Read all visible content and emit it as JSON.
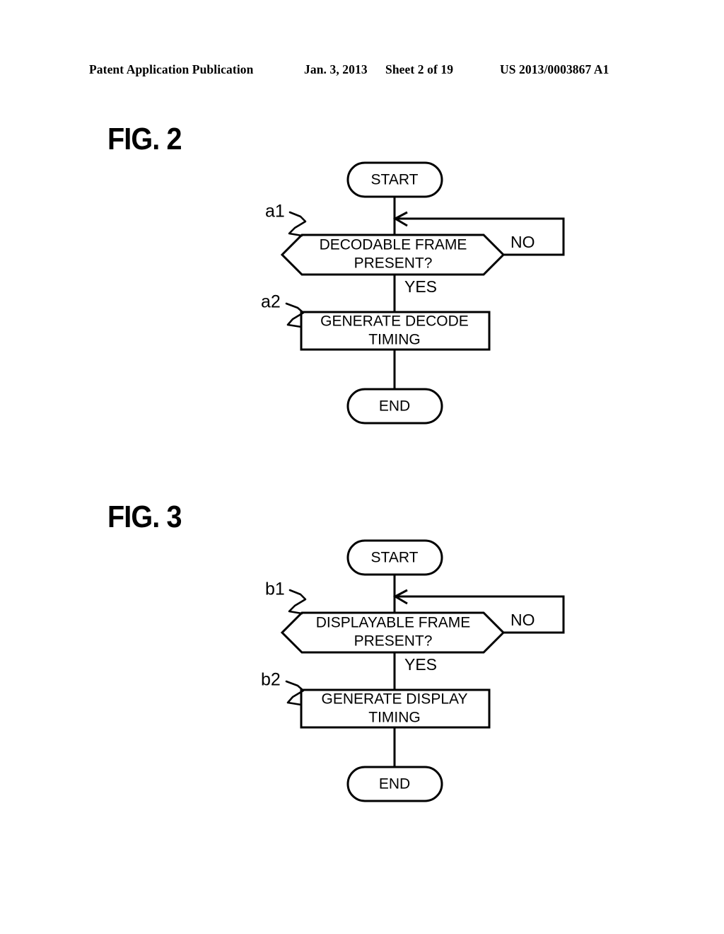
{
  "header": {
    "publication": "Patent Application Publication",
    "date": "Jan. 3, 2013",
    "sheet": "Sheet 2 of 19",
    "patent_number": "US 2013/0003867 A1"
  },
  "figures": [
    {
      "title": "FIG. 2",
      "start_label": "START",
      "decision_label_line1": "DECODABLE FRAME",
      "decision_label_line2": "PRESENT?",
      "decision_ref": "a1",
      "no_label": "NO",
      "yes_label": "YES",
      "process_label_line1": "GENERATE DECODE",
      "process_label_line2": "TIMING",
      "process_ref": "a2",
      "end_label": "END"
    },
    {
      "title": "FIG. 3",
      "start_label": "START",
      "decision_label_line1": "DISPLAYABLE FRAME",
      "decision_label_line2": "PRESENT?",
      "decision_ref": "b1",
      "no_label": "NO",
      "yes_label": "YES",
      "process_label_line1": "GENERATE DISPLAY",
      "process_label_line2": "TIMING",
      "process_ref": "b2",
      "end_label": "END"
    }
  ],
  "colors": {
    "ink": "#000000",
    "paper": "#ffffff"
  }
}
